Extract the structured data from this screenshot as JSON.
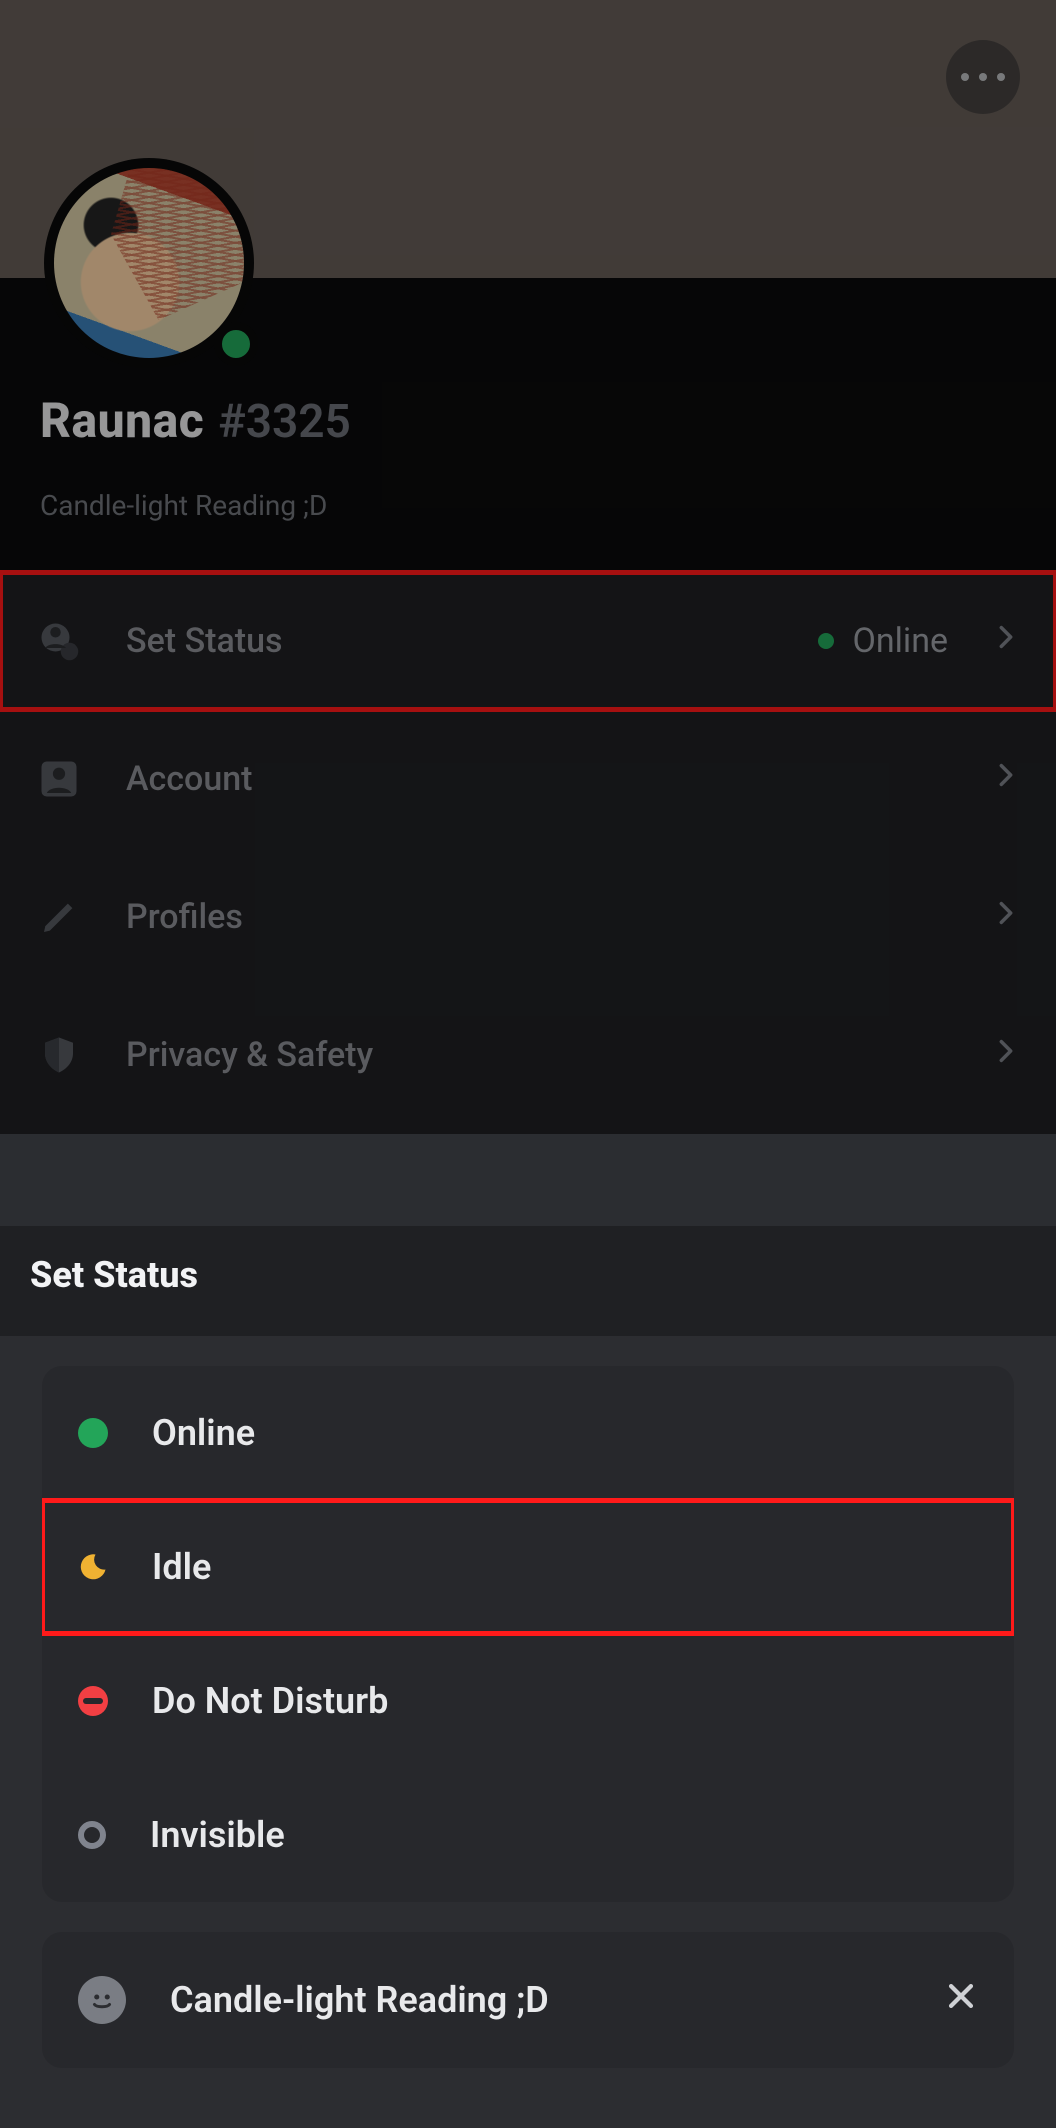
{
  "header": {
    "username": "Raunac",
    "discriminator": "#3325",
    "custom_status": "Candle-light Reading ;D"
  },
  "settings": {
    "set_status_label": "Set Status",
    "status_value": "Online",
    "account_label": "Account",
    "profiles_label": "Profiles",
    "privacy_label": "Privacy & Safety"
  },
  "sheet": {
    "title": "Set Status",
    "options": {
      "online": "Online",
      "idle": "Idle",
      "dnd": "Do Not Disturb",
      "invisible": "Invisible"
    },
    "custom_status_text": "Candle-light Reading ;D"
  },
  "colors": {
    "online": "#23a559",
    "idle": "#f0b232",
    "dnd": "#f23f43",
    "offline": "#80848e",
    "highlight": "#ff1a1a"
  }
}
